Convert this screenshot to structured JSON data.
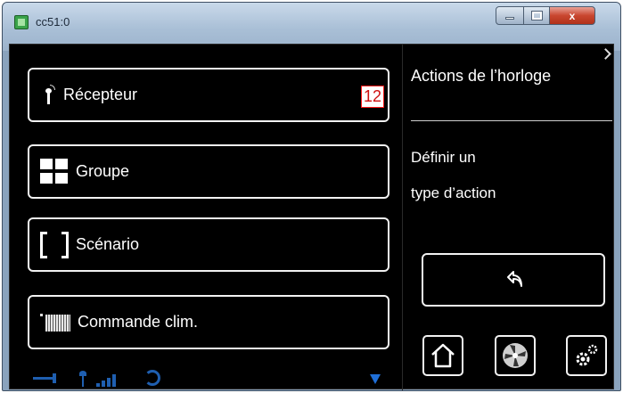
{
  "window": {
    "title": "cc51:0",
    "controls": {
      "minimize": "minimize",
      "maximize": "maximize",
      "close": "x"
    }
  },
  "menu": {
    "items": [
      {
        "label": "Récepteur",
        "icon": "antenna-icon",
        "badge": "12"
      },
      {
        "label": "Groupe",
        "icon": "grid-icon"
      },
      {
        "label": "Scénario",
        "icon": "bracket-icon"
      },
      {
        "label": "Commande clim.",
        "icon": "radiator-icon"
      }
    ]
  },
  "status_bar": {
    "icons": [
      "plug-icon",
      "signal-antenna-icon",
      "signal-bars-icon",
      "sync-icon",
      "scroll-down-icon"
    ]
  },
  "right_panel": {
    "title": "Actions de l’horloge",
    "text_line_1": "Définir un",
    "text_line_2": "type d’action",
    "buttons": [
      "back-arrow-icon",
      "home-icon",
      "fan-icon",
      "settings-icon"
    ]
  },
  "colors": {
    "background": "#000000",
    "foreground": "#ffffff",
    "badge_border": "#ff1a1a",
    "status_icon": "#1f5fb0"
  }
}
